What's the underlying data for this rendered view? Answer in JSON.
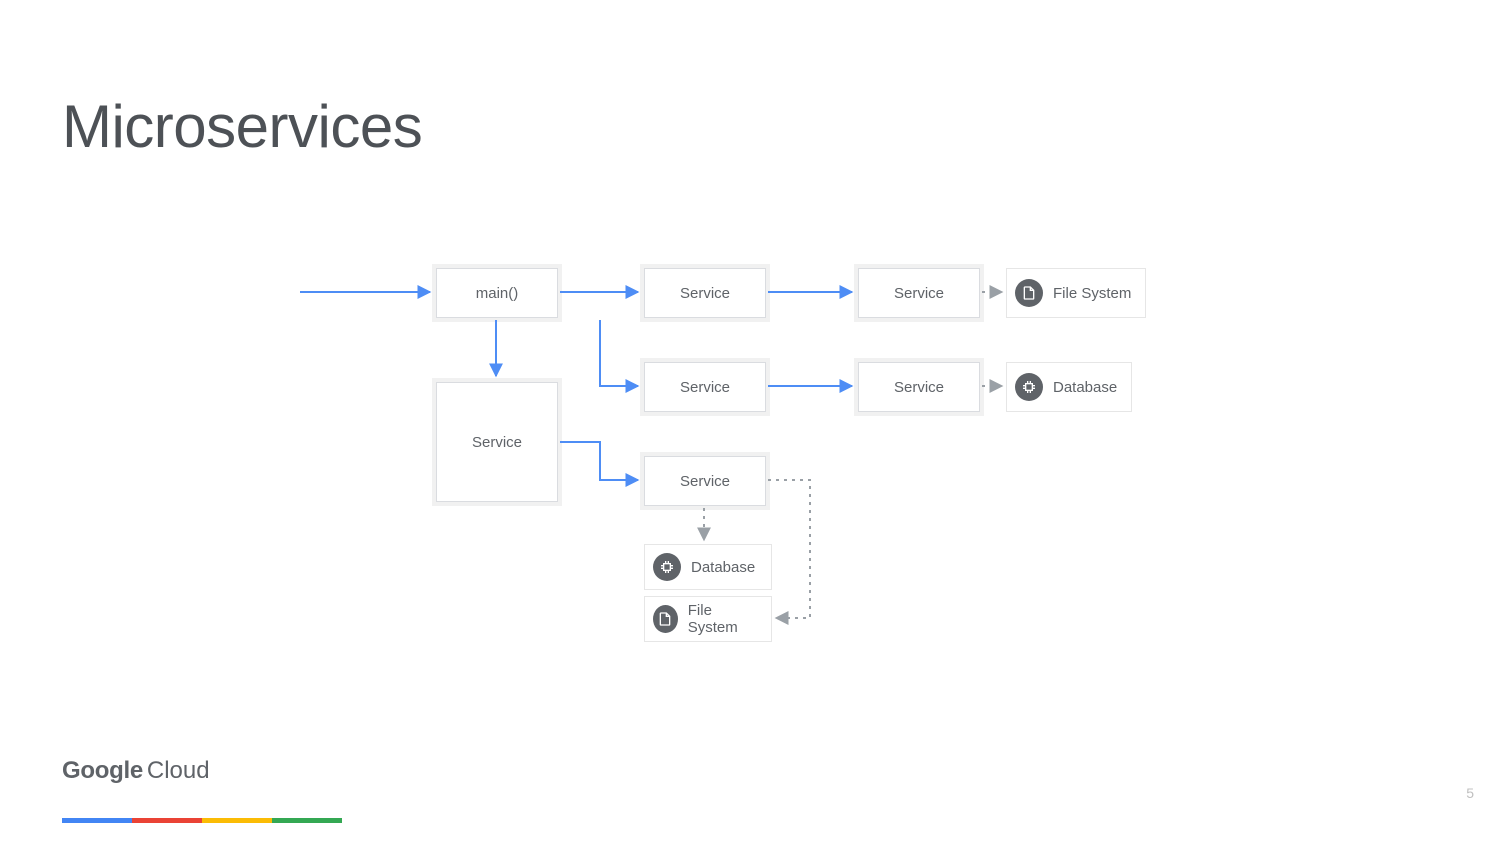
{
  "title": "Microservices",
  "page_number": "5",
  "brand": {
    "google": "Google",
    "cloud": "Cloud"
  },
  "nodes": {
    "main": "main()",
    "svc_top_a": "Service",
    "svc_top_b": "Service",
    "svc_mid_a": "Service",
    "svc_mid_b": "Service",
    "svc_left": "Service",
    "svc_bot": "Service"
  },
  "resources": {
    "fs_top": "File System",
    "db_mid": "Database",
    "db_bot": "Database",
    "fs_bot": "File System"
  },
  "stripe_colors": [
    "#4285f4",
    "#ea4335",
    "#fbbc05",
    "#34a853"
  ],
  "arrow_color": "#4e8df5",
  "dotted_color": "#9aa0a6",
  "edges_solid": [
    {
      "from": "entry",
      "to": "main"
    },
    {
      "from": "main",
      "to": "svc_top_a"
    },
    {
      "from": "svc_top_a",
      "to": "svc_top_b"
    },
    {
      "from": "main",
      "to": "svc_mid_a",
      "bend": "down-right"
    },
    {
      "from": "svc_mid_a",
      "to": "svc_mid_b"
    },
    {
      "from": "main",
      "to": "svc_left",
      "dir": "down"
    },
    {
      "from": "svc_left",
      "to": "svc_bot",
      "bend": "down-right"
    }
  ],
  "edges_dotted": [
    {
      "from": "svc_top_b",
      "to": "fs_top"
    },
    {
      "from": "svc_mid_b",
      "to": "db_mid"
    },
    {
      "from": "svc_bot",
      "to": "db_bot",
      "dir": "down"
    },
    {
      "from": "svc_bot",
      "to": "fs_bot",
      "bend": "right-down-left"
    }
  ]
}
